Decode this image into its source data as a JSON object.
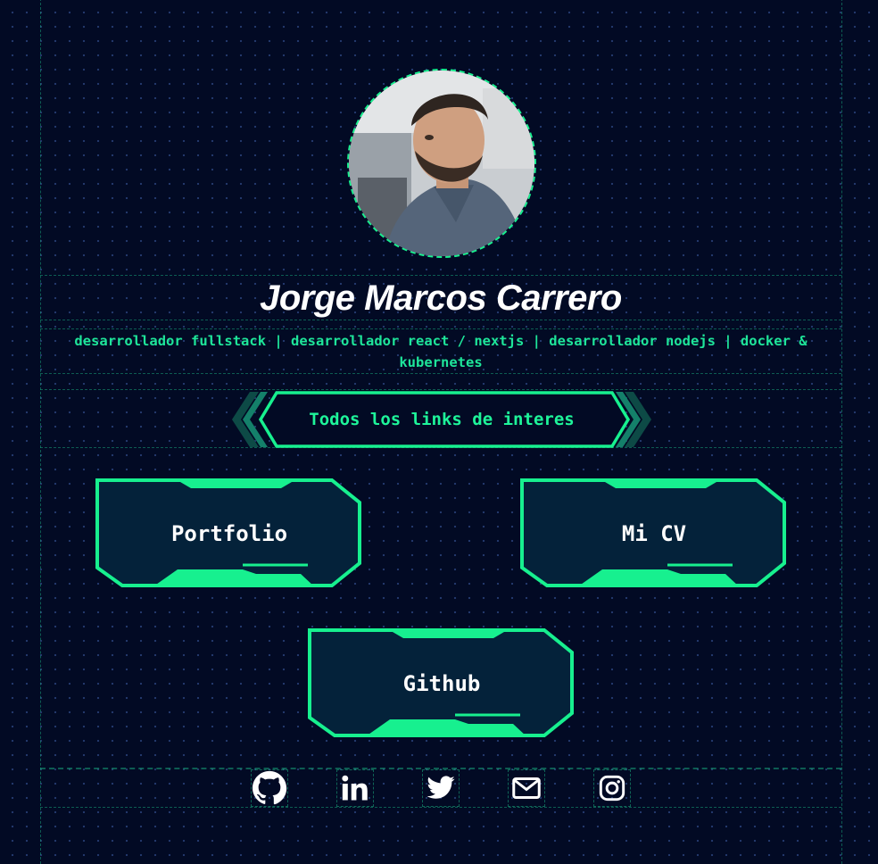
{
  "profile": {
    "name": "Jorge Marcos Carrero",
    "subtitle": "desarrollador fullstack | desarrollador react / nextjs | desarrollador nodejs | docker & kubernetes",
    "avatar_alt": "Jorge Marcos Carrero"
  },
  "section": {
    "heading": "Todos los links de interes"
  },
  "links": [
    {
      "label": "Portfolio"
    },
    {
      "label": "Mi CV"
    },
    {
      "label": "Github"
    }
  ],
  "socials": [
    {
      "icon": "github-icon"
    },
    {
      "icon": "linkedin-icon"
    },
    {
      "icon": "twitter-icon"
    },
    {
      "icon": "mail-icon"
    },
    {
      "icon": "instagram-icon"
    }
  ],
  "colors": {
    "background": "#020a24",
    "accent": "#17f08f",
    "button_fill": "#04223a",
    "text": "#ffffff"
  }
}
